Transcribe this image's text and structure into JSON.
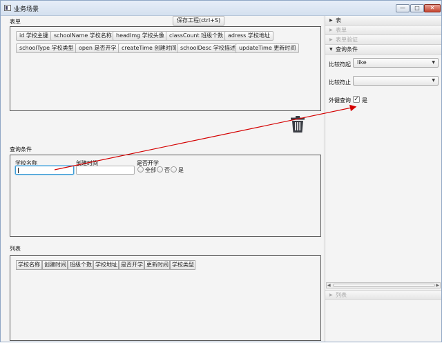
{
  "window": {
    "title": "业务场景",
    "controls": {
      "minimize": "—",
      "maximize": "□",
      "close": "✕"
    }
  },
  "form_section": {
    "label": "表单",
    "save_button": "保存工程(ctrl+S)",
    "fields": [
      "id 学校主键",
      "schoolName 学校名称",
      "headImg 学校头像",
      "classCount 班级个数",
      "adress 学校地址",
      "schoolType 学校类型",
      "open 是否开学",
      "createTime 创建时间",
      "schoolDesc 学校描述",
      "updateTime 更新时间"
    ]
  },
  "query_section": {
    "label": "查询条件",
    "school_name_label": "学校名称",
    "create_time_label": "创建时间",
    "open_label": "是否开学",
    "radio_all": "全部",
    "radio_no": "否",
    "radio_yes": "是"
  },
  "list_section": {
    "label": "列表",
    "columns": [
      "学校名称",
      "创建时间",
      "班级个数",
      "学校地址",
      "是否开学",
      "更新时间",
      "学校类型"
    ]
  },
  "right_panel": {
    "accordion": [
      {
        "label": "表",
        "disabled": false,
        "expanded": false
      },
      {
        "label": "表单",
        "disabled": true,
        "expanded": false
      },
      {
        "label": "表单验证",
        "disabled": true,
        "expanded": false
      },
      {
        "label": "查询条件",
        "disabled": false,
        "expanded": true
      }
    ],
    "compare_start_label": "比较符起",
    "compare_start_value": "like",
    "compare_end_label": "比较符止",
    "compare_end_value": "",
    "foreign_key_label": "外键查询",
    "foreign_key_checked": true,
    "foreign_key_option": "是",
    "bottom_accordion": {
      "label": "列表",
      "disabled": true
    }
  },
  "colors": {
    "arrow": "#d40000",
    "focus": "#3c9bd4",
    "trash": "#3a3d44"
  }
}
